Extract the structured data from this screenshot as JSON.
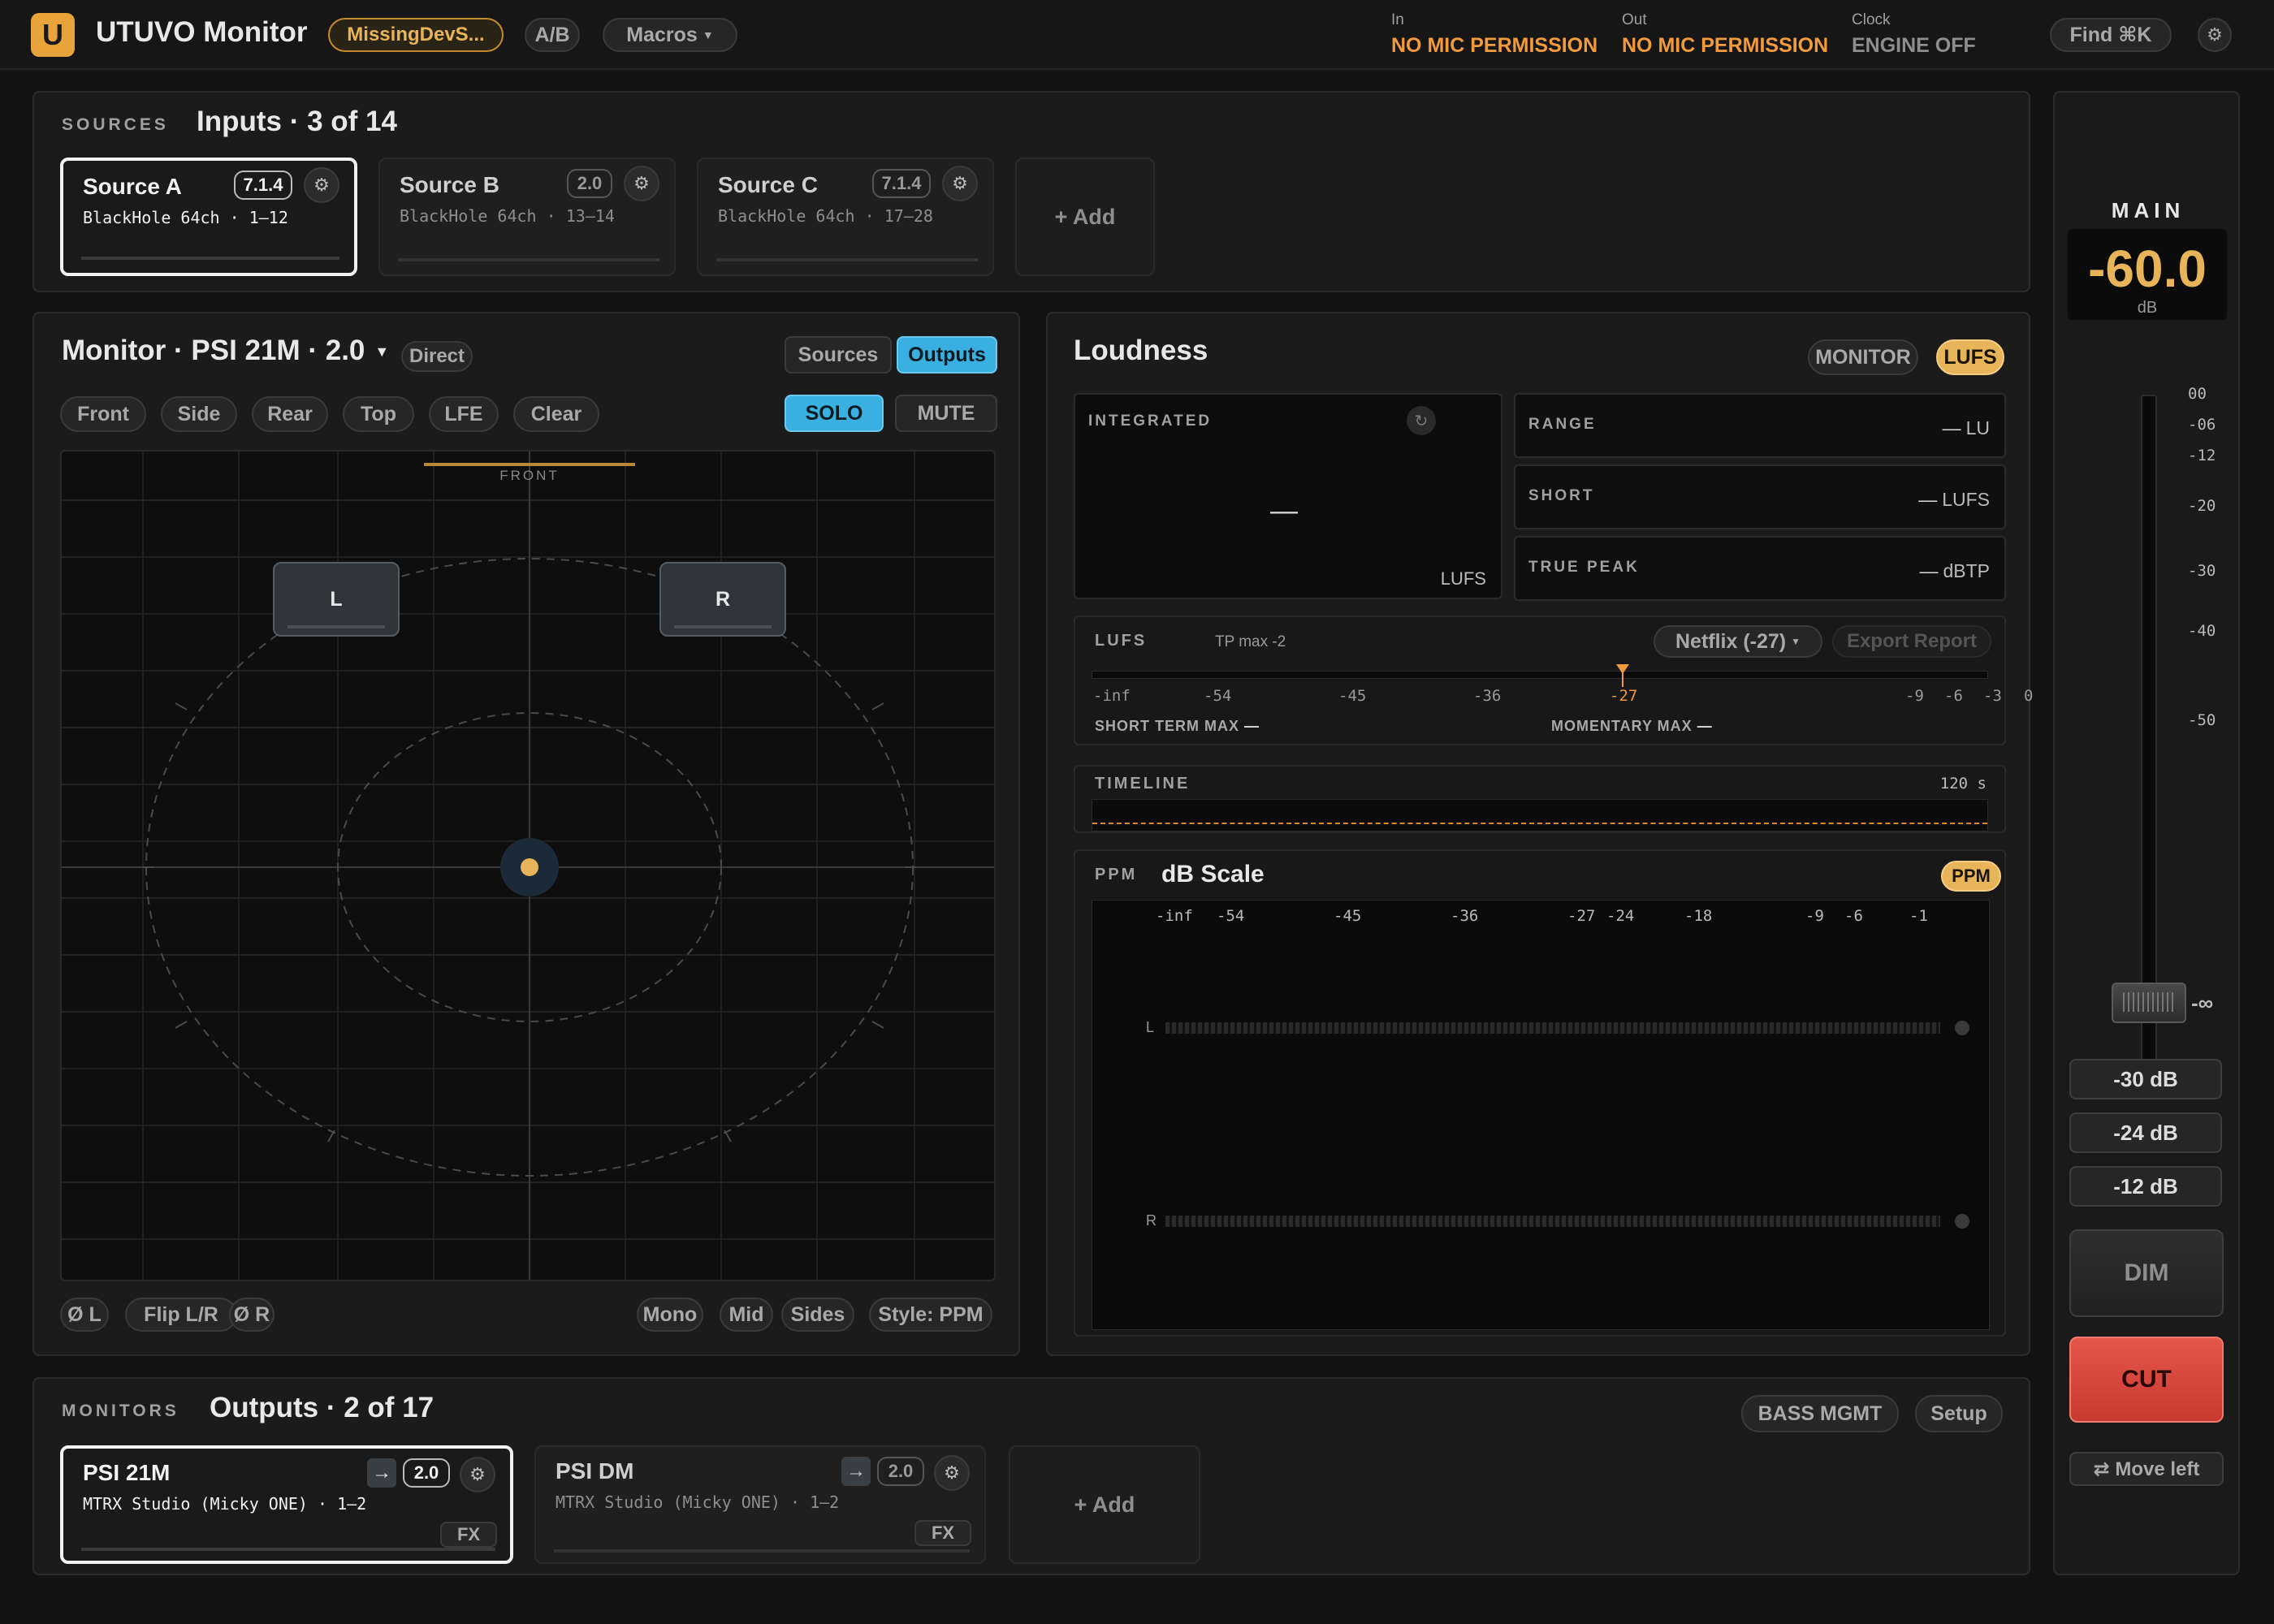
{
  "topbar": {
    "logo_letter": "U",
    "app_title": "UTUVO Monitor",
    "device_chip": "MissingDevS...",
    "ab_label": "A/B",
    "macros_label": "Macros",
    "in_label": "In",
    "in_value": "NO MIC PERMISSION",
    "out_label": "Out",
    "out_value": "NO MIC PERMISSION",
    "clock_label": "Clock",
    "clock_value": "ENGINE OFF",
    "find_label": "Find ⌘K",
    "colors": {
      "accent": "#e8a33a",
      "warning": "#f29a3c"
    }
  },
  "sources": {
    "section_label": "SOURCES",
    "title": "Inputs · 3 of 14",
    "items": [
      {
        "name": "Source A",
        "format": "7.1.4",
        "device": "BlackHole 64ch · 1–12",
        "selected": true
      },
      {
        "name": "Source B",
        "format": "2.0",
        "device": "BlackHole 64ch · 13–14",
        "selected": false
      },
      {
        "name": "Source C",
        "format": "7.1.4",
        "device": "BlackHole 64ch · 17–28",
        "selected": false
      }
    ],
    "add_label": "+ Add"
  },
  "monitor": {
    "title": "Monitor · PSI 21M · 2.0",
    "mode_chip": "Direct",
    "view_sources": "Sources",
    "view_outputs": "Outputs",
    "groups": [
      "Front",
      "Side",
      "Rear",
      "Top",
      "LFE",
      "Clear"
    ],
    "solo": "SOLO",
    "mute": "MUTE",
    "front_label": "FRONT",
    "speakers": [
      "L",
      "R"
    ],
    "bottom_left": [
      "Ø L",
      "Flip L/R",
      "Ø R"
    ],
    "bottom_right": [
      "Mono",
      "Mid",
      "Sides",
      "Style: PPM"
    ]
  },
  "loudness": {
    "title": "Loudness",
    "mode_monitor": "MONITOR",
    "mode_lufs": "LUFS",
    "integrated_label": "INTEGRATED",
    "integrated_value": "—",
    "integrated_unit": "LUFS",
    "range_label": "RANGE",
    "range_value": "—",
    "range_unit": "LU",
    "short_label": "SHORT",
    "short_value": "—",
    "short_unit": "LUFS",
    "truepeak_label": "TRUE PEAK",
    "truepeak_value": "—",
    "truepeak_unit": "dBTP",
    "lufs_label": "LUFS",
    "tp_max": "TP max -2",
    "preset": "Netflix (-27)",
    "export": "Export Report",
    "scale": [
      "-inf",
      "-54",
      "-45",
      "-36",
      "-27",
      "-9",
      "-6",
      "-3",
      "0"
    ],
    "target": -27,
    "short_max_label": "SHORT TERM MAX",
    "short_max_value": "—",
    "momentary_max_label": "MOMENTARY MAX",
    "momentary_max_value": "—",
    "timeline_label": "TIMELINE",
    "timeline_span": "120 s",
    "ppm_label": "PPM",
    "ppm_title": "dB Scale",
    "ppm_chip": "PPM",
    "ppm_scale": [
      "-inf",
      "-54",
      "-45",
      "-36",
      "-27",
      "-24",
      "-18",
      "-9",
      "-6",
      "-1"
    ],
    "channels": [
      "L",
      "R"
    ]
  },
  "main": {
    "label": "MAIN",
    "value": "-60.0",
    "unit": "dB",
    "scale": [
      "00",
      "-06",
      "-12",
      "-20",
      "-30",
      "-40",
      "-50"
    ],
    "fader_min": "-∞",
    "presets": [
      "-30 dB",
      "-24 dB",
      "-12 dB"
    ],
    "dim": "DIM",
    "cut": "CUT",
    "move": "⇄ Move left"
  },
  "outputs": {
    "section_label": "MONITORS",
    "title": "Outputs · 2 of 17",
    "bass_mgmt": "BASS MGMT",
    "setup": "Setup",
    "items": [
      {
        "name": "PSI 21M",
        "format": "2.0",
        "device": "MTRX Studio (Micky ONE) · 1–2",
        "fx": "FX",
        "selected": true
      },
      {
        "name": "PSI DM",
        "format": "2.0",
        "device": "MTRX Studio (Micky ONE) · 1–2",
        "fx": "FX",
        "selected": false
      }
    ],
    "add_label": "+ Add"
  }
}
